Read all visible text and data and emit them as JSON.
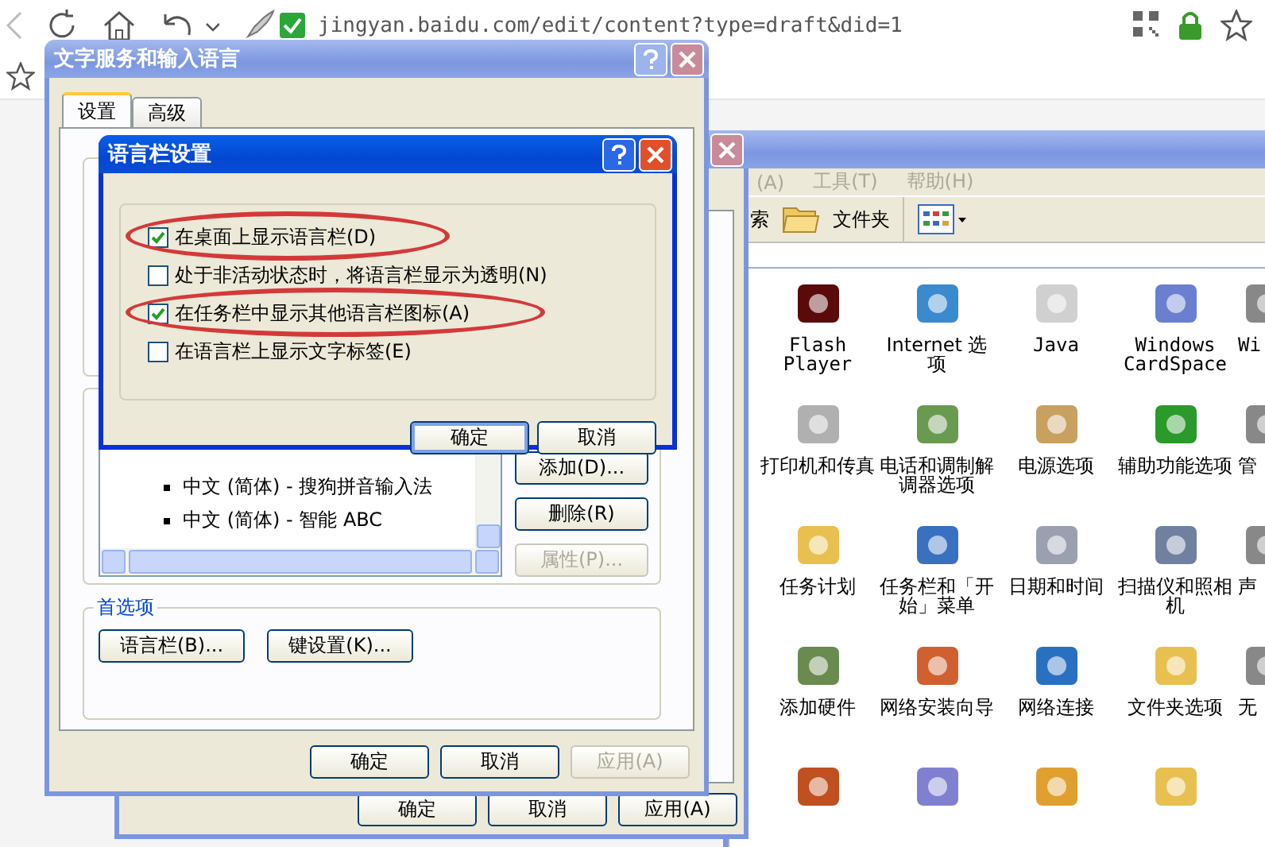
{
  "browser": {
    "url": "jingyan.baidu.com/edit/content?type=draft&did=1"
  },
  "control_panel": {
    "menu": [
      "(A)",
      "工具(T)",
      "帮助(H)"
    ],
    "toolbar": [
      "索",
      "文件夹"
    ],
    "items": [
      {
        "label": "Flash Player"
      },
      {
        "label": "Internet 选项"
      },
      {
        "label": "Java"
      },
      {
        "label": "Windows CardSpace"
      },
      {
        "label": "Wi"
      },
      {
        "label": "打印机和传真"
      },
      {
        "label": "电话和调制解调器选项"
      },
      {
        "label": "电源选项"
      },
      {
        "label": "辅助功能选项"
      },
      {
        "label": "管"
      },
      {
        "label": "任务计划"
      },
      {
        "label": "任务栏和「开始」菜单"
      },
      {
        "label": "日期和时间"
      },
      {
        "label": "扫描仪和照相机"
      },
      {
        "label": "声"
      },
      {
        "label": "添加硬件"
      },
      {
        "label": "网络安装向导"
      },
      {
        "label": "网络连接"
      },
      {
        "label": "文件夹选项"
      },
      {
        "label": "无"
      }
    ]
  },
  "regional_dialog": {
    "buttons": [
      {
        "label": "确定",
        "disabled": false
      },
      {
        "label": "取消",
        "disabled": false
      },
      {
        "label": "应用(A)",
        "disabled": false
      }
    ]
  },
  "text_services": {
    "title": "文字服务和输入语言",
    "tabs": [
      {
        "label": "设置",
        "selected": true
      },
      {
        "label": "高级",
        "selected": false
      }
    ],
    "installed": [
      "中文 (简体) - 搜狗拼音输入法",
      "中文 (简体) - 智能 ABC"
    ],
    "side_buttons": [
      {
        "label": "添加(D)...",
        "disabled": false
      },
      {
        "label": "删除(R)",
        "disabled": false
      },
      {
        "label": "属性(P)...",
        "disabled": true
      }
    ],
    "preferences": {
      "title": "首选项",
      "buttons": [
        "语言栏(B)...",
        "键设置(K)..."
      ]
    },
    "buttons": [
      {
        "label": "确定",
        "disabled": false
      },
      {
        "label": "取消",
        "disabled": false
      },
      {
        "label": "应用(A)",
        "disabled": true
      }
    ]
  },
  "language_bar": {
    "title": "语言栏设置",
    "options": [
      {
        "label": "在桌面上显示语言栏(D)",
        "checked": true,
        "circled": true
      },
      {
        "label": "处于非活动状态时，将语言栏显示为透明(N)",
        "checked": false,
        "circled": false
      },
      {
        "label": "在任务栏中显示其他语言栏图标(A)",
        "checked": true,
        "circled": true
      },
      {
        "label": "在语言栏上显示文字标签(E)",
        "checked": false,
        "circled": false
      }
    ],
    "buttons": [
      {
        "label": "确定",
        "default": true
      },
      {
        "label": "取消",
        "default": false
      }
    ]
  }
}
